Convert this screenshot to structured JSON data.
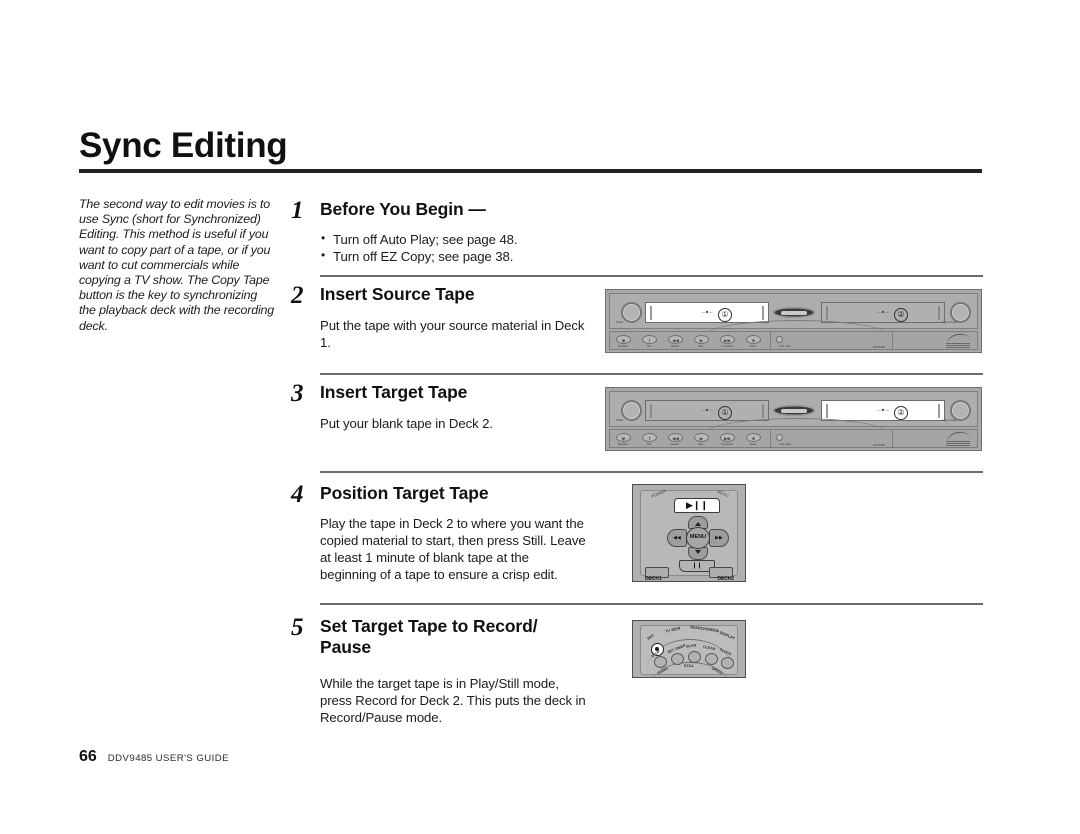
{
  "document": {
    "title": "Sync Editing",
    "sidebar_note": "The second way to edit movies is to use Sync (short for Synchronized) Editing. This method is useful if you want to copy part of a tape, or if you want to cut commercials while copying a TV show. The Copy Tape button is the key to synchronizing the playback deck with the recording deck.",
    "footer": {
      "page_number": "66",
      "guide_title": "DDV9485 USER'S GUIDE"
    }
  },
  "steps": [
    {
      "number": "1",
      "heading": "Before You Begin —",
      "bullets": [
        "Turn off Auto Play; see page 48.",
        "Turn off EZ Copy; see page 38."
      ]
    },
    {
      "number": "2",
      "heading": "Insert Source Tape",
      "body": "Put the tape with your source material in Deck 1."
    },
    {
      "number": "3",
      "heading": "Insert Target Tape",
      "body": "Put your blank tape in Deck 2."
    },
    {
      "number": "4",
      "heading": "Position Target Tape",
      "body": "Play the tape in Deck 2 to where you want the copied material to start, then press Still. Leave at least 1 minute of blank tape at the beginning of a tape to ensure a crisp edit."
    },
    {
      "number": "5",
      "heading": "Set Target Tape to Record/ Pause",
      "body": "While the target tape is in Play/Still mode, press Record for Deck 2. This puts the deck in Record/Pause mode."
    }
  ],
  "illustrations": {
    "vcr_deck1_lit": {
      "deck1_label": "①",
      "deck2_label": "②",
      "slot_text": "— ■ —",
      "power_label": "Power",
      "copy_tape_label": "Copy a Tape",
      "buttons": [
        "Rec/Stop",
        "Still",
        "Rewind",
        "Play",
        "F Forward",
        "Select"
      ],
      "button_glyphs": [
        "◉",
        "‖",
        "◀◀",
        "▶",
        "▶▶",
        "■"
      ],
      "copy_button_label": "Copy Tape",
      "panel_label": "DDV9485"
    },
    "vcr_deck2_lit": {
      "deck1_label": "①",
      "deck2_label": "②",
      "slot_text": "— ■ —",
      "power_label": "Power",
      "copy_tape_label": "Copy a Tape",
      "buttons": [
        "Rec/Stop",
        "Still",
        "Rewind",
        "Play",
        "F Forward",
        "Select"
      ],
      "button_glyphs": [
        "◉",
        "‖",
        "◀◀",
        "▶",
        "▶▶",
        "■"
      ],
      "copy_button_label": "Copy Tape",
      "panel_label": "DDV9485"
    },
    "remote_dpad": {
      "play_pause_label": "▶❙❙",
      "menu_label": "MENU",
      "left_label": "◀◀",
      "right_label": "▶▶",
      "still_label": "❙❙",
      "deck1_label": "DECK1",
      "deck2_label": "DECK2",
      "top_left_label": "POWER",
      "top_right_label": "MENU"
    },
    "remote_rec": {
      "rec_label": "REC",
      "tv_view_label": "TV VIEW",
      "search_index_label": "SEARCH/INDEX",
      "display_label": "+ DISPLAY",
      "buttons": [
        "STOP",
        "SET TIMER",
        "SCAN",
        "CLEAR",
        "CLOCK"
      ],
      "still_label": "STILL",
      "left_bottom_label": "AUDIO",
      "right_bottom_label": "SPEED"
    }
  },
  "colors": {
    "page_background": "#ffffff",
    "text": "#1a1a1a",
    "rule": "#6d6d6d",
    "title_rule": "#222222",
    "device_body": "#a8a8a8",
    "device_lit_slot": "#ffffff"
  }
}
